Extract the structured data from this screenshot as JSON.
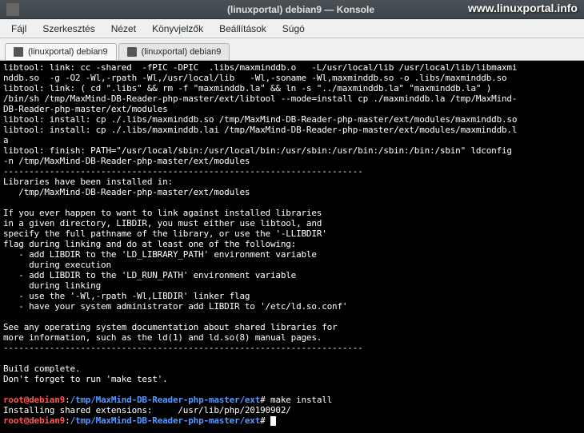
{
  "watermark": "www.linuxportal.info",
  "titlebar": {
    "title": "(linuxportal) debian9 — Konsole"
  },
  "menubar": {
    "items": [
      "Fájl",
      "Szerkesztés",
      "Nézet",
      "Könyvjelzők",
      "Beállítások",
      "Súgó"
    ]
  },
  "tabs": [
    {
      "label": "(linuxportal) debian9",
      "active": true
    },
    {
      "label": "(linuxportal) debian9",
      "active": false
    }
  ],
  "terminal": {
    "lines": [
      "libtool: link: cc -shared  -fPIC -DPIC  .libs/maxminddb.o   -L/usr/local/lib /usr/local/lib/libmaxmi",
      "nddb.so  -g -O2 -Wl,-rpath -Wl,/usr/local/lib   -Wl,-soname -Wl,maxminddb.so -o .libs/maxminddb.so",
      "libtool: link: ( cd \".libs\" && rm -f \"maxminddb.la\" && ln -s \"../maxminddb.la\" \"maxminddb.la\" )",
      "/bin/sh /tmp/MaxMind-DB-Reader-php-master/ext/libtool --mode=install cp ./maxminddb.la /tmp/MaxMind-",
      "DB-Reader-php-master/ext/modules",
      "libtool: install: cp ./.libs/maxminddb.so /tmp/MaxMind-DB-Reader-php-master/ext/modules/maxminddb.so",
      "libtool: install: cp ./.libs/maxminddb.lai /tmp/MaxMind-DB-Reader-php-master/ext/modules/maxminddb.l",
      "a",
      "libtool: finish: PATH=\"/usr/local/sbin:/usr/local/bin:/usr/sbin:/usr/bin:/sbin:/bin:/sbin\" ldconfig ",
      "-n /tmp/MaxMind-DB-Reader-php-master/ext/modules",
      "----------------------------------------------------------------------",
      "Libraries have been installed in:",
      "   /tmp/MaxMind-DB-Reader-php-master/ext/modules",
      "",
      "If you ever happen to want to link against installed libraries",
      "in a given directory, LIBDIR, you must either use libtool, and",
      "specify the full pathname of the library, or use the '-LLIBDIR'",
      "flag during linking and do at least one of the following:",
      "   - add LIBDIR to the 'LD_LIBRARY_PATH' environment variable",
      "     during execution",
      "   - add LIBDIR to the 'LD_RUN_PATH' environment variable",
      "     during linking",
      "   - use the '-Wl,-rpath -Wl,LIBDIR' linker flag",
      "   - have your system administrator add LIBDIR to '/etc/ld.so.conf'",
      "",
      "See any operating system documentation about shared libraries for",
      "more information, such as the ld(1) and ld.so(8) manual pages.",
      "----------------------------------------------------------------------",
      "",
      "Build complete.",
      "Don't forget to run 'make test'.",
      ""
    ],
    "prompt1": {
      "user": "root@debian9",
      "sep": ":",
      "path": "/tmp/MaxMind-DB-Reader-php-master/ext",
      "hash": "#",
      "cmd": " make install"
    },
    "post_lines": [
      "Installing shared extensions:     /usr/lib/php/20190902/"
    ],
    "prompt2": {
      "user": "root@debian9",
      "sep": ":",
      "path": "/tmp/MaxMind-DB-Reader-php-master/ext",
      "hash": "#",
      "cmd": " "
    }
  }
}
